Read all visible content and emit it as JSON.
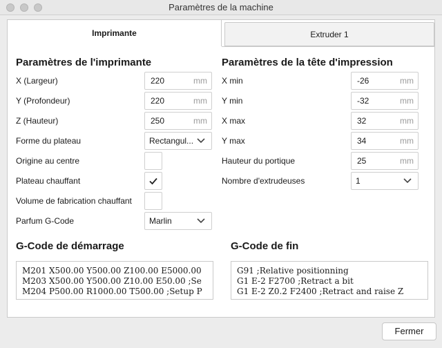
{
  "window": {
    "title": "Paramètres de la machine"
  },
  "tabs": [
    {
      "label": "Imprimante",
      "active": true
    },
    {
      "label": "Extruder 1",
      "active": false
    }
  ],
  "printer": {
    "title": "Paramètres de l'imprimante",
    "fields": [
      {
        "label": "X (Largeur)",
        "value": "220",
        "unit": "mm"
      },
      {
        "label": "Y (Profondeur)",
        "value": "220",
        "unit": "mm"
      },
      {
        "label": "Z (Hauteur)",
        "value": "250",
        "unit": "mm"
      }
    ],
    "build_plate": {
      "label": "Forme du plateau",
      "value": "Rectangul..."
    },
    "origin_center": {
      "label": "Origine au centre",
      "checked": false
    },
    "heated_bed": {
      "label": "Plateau chauffant",
      "checked": true
    },
    "heated_volume": {
      "label": "Volume de fabrication chauffant",
      "checked": false
    },
    "gcode_flavor": {
      "label": "Parfum G-Code",
      "value": "Marlin"
    }
  },
  "head": {
    "title": "Paramètres de la tête d'impression",
    "fields": [
      {
        "label": "X min",
        "value": "-26",
        "unit": "mm"
      },
      {
        "label": "Y min",
        "value": "-32",
        "unit": "mm"
      },
      {
        "label": "X max",
        "value": "32",
        "unit": "mm"
      },
      {
        "label": "Y max",
        "value": "34",
        "unit": "mm"
      },
      {
        "label": "Hauteur du portique",
        "value": "25",
        "unit": "mm"
      }
    ],
    "extruders": {
      "label": "Nombre d'extrudeuses",
      "value": "1"
    }
  },
  "start_gcode": {
    "title": "G-Code de démarrage",
    "lines": [
      "M201 X500.00 Y500.00 Z100.00 E5000.00",
      "M203 X500.00 Y500.00 Z10.00 E50.00 ;Se",
      "M204 P500.00 R1000.00 T500.00 ;Setup P"
    ]
  },
  "end_gcode": {
    "title": "G-Code de fin",
    "lines": [
      "G91 ;Relative positionning",
      "G1 E-2 F2700 ;Retract a bit",
      "G1 E-2 Z0.2 F2400 ;Retract and raise Z"
    ]
  },
  "footer": {
    "close_label": "Fermer"
  },
  "icons": {
    "chevron": "chevron-down-icon",
    "check": "checkmark-icon"
  }
}
